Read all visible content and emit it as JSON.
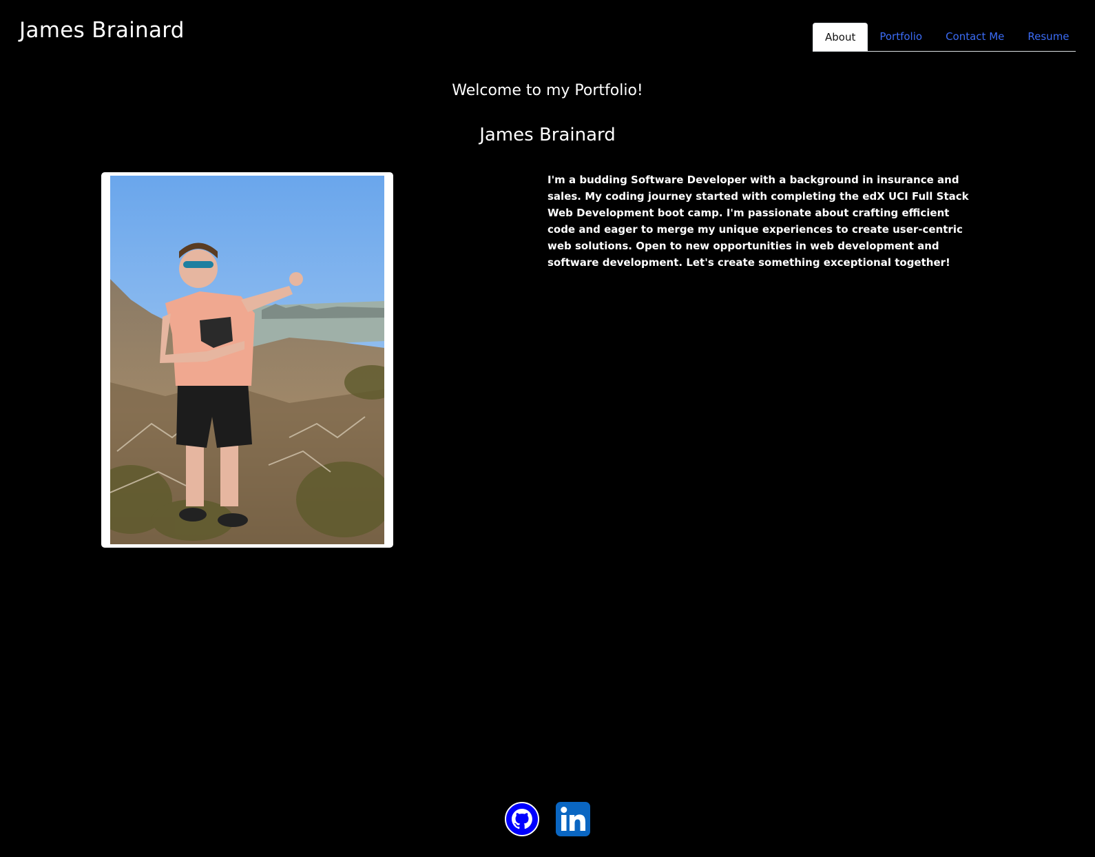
{
  "header": {
    "title": "James Brainard",
    "nav": [
      {
        "label": "About",
        "active": true
      },
      {
        "label": "Portfolio",
        "active": false
      },
      {
        "label": "Contact Me",
        "active": false
      },
      {
        "label": "Resume",
        "active": false
      }
    ]
  },
  "main": {
    "welcome": "Welcome to my Portfolio!",
    "name": "James Brainard",
    "bio": "I'm a budding Software Developer with a background in insurance and sales. My coding journey started with completing the edX UCI Full Stack Web Development boot camp. I'm passionate about crafting efficient code and eager to merge my unique experiences to create user-centric web solutions. Open to new opportunities in web development and software development. Let's create something exceptional together!"
  },
  "footer": {
    "icons": [
      "github-icon",
      "linkedin-icon"
    ]
  },
  "colors": {
    "background": "#000000",
    "nav_link": "#3b6cf6",
    "github_blue": "#0000ff",
    "linkedin_blue": "#0a66c2"
  }
}
